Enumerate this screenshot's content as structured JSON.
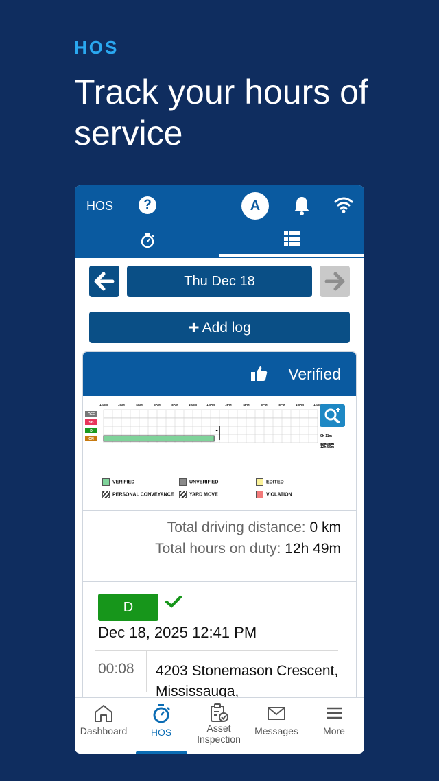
{
  "promo": {
    "kicker": "HOS",
    "title": "Track your hours of service"
  },
  "appbar": {
    "title": "HOS",
    "help_glyph": "?",
    "avatar_initial": "A",
    "icons": [
      "help-icon",
      "bell-icon",
      "wifi-icon"
    ],
    "tabs": [
      {
        "name": "timer",
        "icon": "stopwatch-icon",
        "active": false
      },
      {
        "name": "logs",
        "icon": "list-icon",
        "active": true
      }
    ]
  },
  "log_nav": {
    "date": "Thu Dec 18",
    "add_log_label": "Add log"
  },
  "log_card": {
    "status_label": "Verified",
    "totals": {
      "driving_label": "Total driving distance:",
      "driving_value": "0 km",
      "duty_label": "Total hours on duty:",
      "duty_value": "12h 49m"
    }
  },
  "chart_data": {
    "type": "table",
    "hour_labels": [
      "12AM",
      "2AM",
      "4AM",
      "6AM",
      "8AM",
      "10AM",
      "12PM",
      "2PM",
      "4PM",
      "6PM",
      "8PM",
      "10PM",
      "12AM"
    ],
    "rows": [
      {
        "status": "OFF",
        "total": "0h 0m",
        "color": "#777777"
      },
      {
        "status": "SB",
        "total": "",
        "color": "#e8365c"
      },
      {
        "status": "D",
        "total": "0h 11m",
        "color": "#1a9a20"
      },
      {
        "status": "ON",
        "total": "12h 38m",
        "color": "#c77a10"
      }
    ],
    "segments": [
      {
        "status": "ON",
        "start_hour": 0,
        "end_hour": 12.4
      },
      {
        "status": "D",
        "start_hour": 12.6,
        "end_hour": 12.8
      }
    ],
    "grand_total": "12h 50m",
    "legend": [
      {
        "label": "VERIFIED",
        "color": "#7fd39a"
      },
      {
        "label": "UNVERIFIED",
        "color": "#8a8a8a"
      },
      {
        "label": "EDITED",
        "color": "#fbf29a"
      },
      {
        "label": "PERSONAL CONVEYANCE",
        "color": "hatched"
      },
      {
        "label": "YARD MOVE",
        "color": "hatched"
      },
      {
        "label": "VIOLATION",
        "color": "#f27a7a"
      }
    ]
  },
  "event": {
    "status_badge": "D",
    "timestamp": "Dec 18, 2025 12:41 PM",
    "duration": "00:08",
    "location": "4203 Stonemason Crescent, Mississauga,"
  },
  "bottom_nav": {
    "items": [
      {
        "label": "Dashboard",
        "icon": "home-icon"
      },
      {
        "label": "HOS",
        "icon": "stopwatch-icon",
        "active": true
      },
      {
        "label": "Asset Inspection",
        "icon": "clipboard-check-icon"
      },
      {
        "label": "Messages",
        "icon": "envelope-icon"
      },
      {
        "label": "More",
        "icon": "menu-icon"
      }
    ]
  }
}
